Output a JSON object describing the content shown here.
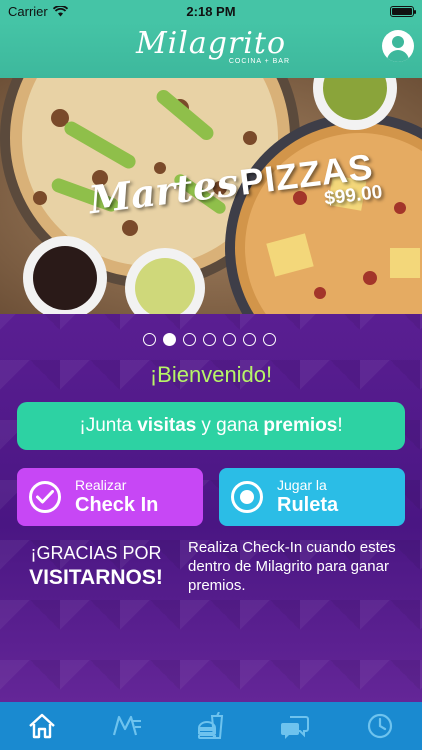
{
  "status_bar": {
    "carrier": "Carrier",
    "time": "2:18 PM"
  },
  "header": {
    "logo_text": "Milagrito",
    "logo_subtext": "COCINA + BAR",
    "account_icon": "user-circle-icon"
  },
  "hero": {
    "promo_word1": "Martes",
    "promo_word2": "PIZZAS",
    "promo_price": "$99.00",
    "page_count": 7,
    "active_page": 2
  },
  "main": {
    "welcome": "¡Bienvenido!",
    "banner": {
      "part1": "¡Junta",
      "part2": "visitas",
      "part3": "y gana",
      "part4": "premios",
      "part5": "!"
    },
    "checkin": {
      "small": "Realizar",
      "big": "Check In",
      "icon": "check-circle-icon"
    },
    "ruleta": {
      "small": "Jugar la",
      "big": "Ruleta",
      "icon": "radio-circle-icon"
    },
    "thanks_line1": "¡GRACIAS POR",
    "thanks_line2": "VISITARNOS!",
    "info_text": "Realiza Check-In cuando estes dentro de Milagrito para ganar premios."
  },
  "tabbar": {
    "tabs": [
      "home-icon",
      "menu-logo-icon",
      "food-drink-icon",
      "chat-icon",
      "clock-icon"
    ],
    "active": "home-icon"
  },
  "colors": {
    "header": "#45c4a6",
    "banner": "#2dd2a3",
    "checkin": "#c747f5",
    "ruleta": "#2bbde6",
    "welcome": "#b7f567",
    "tabbar": "#1a8ad0",
    "background": "#5a1d8f"
  }
}
